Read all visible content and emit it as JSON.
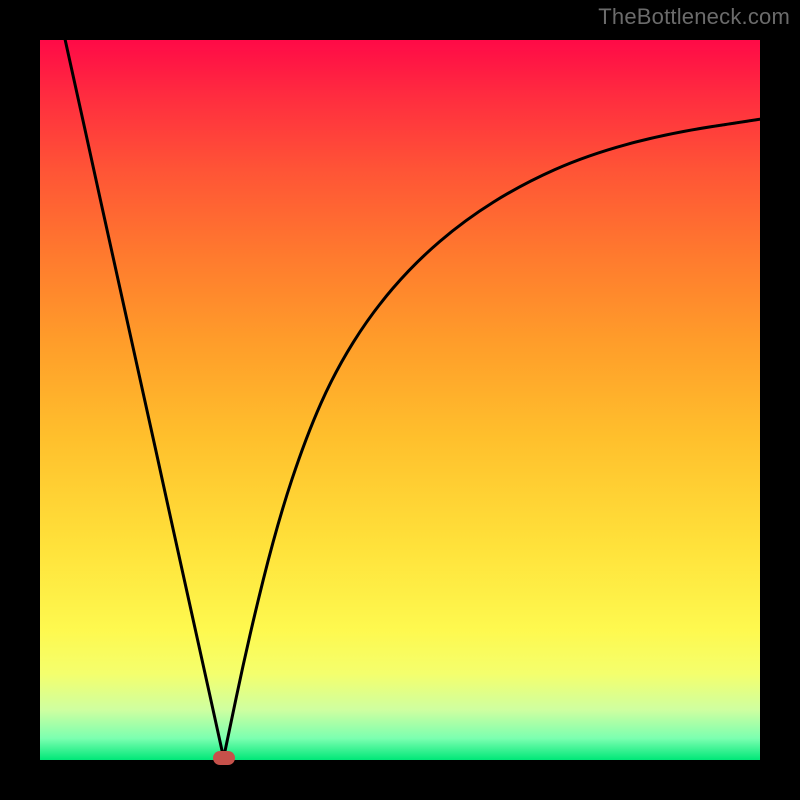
{
  "watermark": "TheBottleneck.com",
  "colors": {
    "marker": "#c6514a",
    "curve": "#000000"
  },
  "chart_data": {
    "type": "line",
    "title": "",
    "xlabel": "",
    "ylabel": "",
    "xlim": [
      0,
      1
    ],
    "ylim": [
      0,
      1
    ],
    "grid": false,
    "series": [
      {
        "name": "left-branch",
        "x": [
          0.035,
          0.06,
          0.085,
          0.11,
          0.135,
          0.16,
          0.185,
          0.21,
          0.235,
          0.255
        ],
        "values": [
          1.0,
          0.887,
          0.773,
          0.66,
          0.547,
          0.434,
          0.32,
          0.207,
          0.094,
          0.003
        ]
      },
      {
        "name": "right-branch",
        "x": [
          0.255,
          0.29,
          0.33,
          0.37,
          0.41,
          0.46,
          0.52,
          0.59,
          0.67,
          0.76,
          0.87,
          1.0
        ],
        "values": [
          0.003,
          0.17,
          0.33,
          0.45,
          0.54,
          0.62,
          0.69,
          0.75,
          0.8,
          0.84,
          0.87,
          0.89
        ]
      }
    ],
    "annotations": [
      {
        "name": "minimum-marker",
        "x": 0.255,
        "y": 0.003
      }
    ]
  }
}
